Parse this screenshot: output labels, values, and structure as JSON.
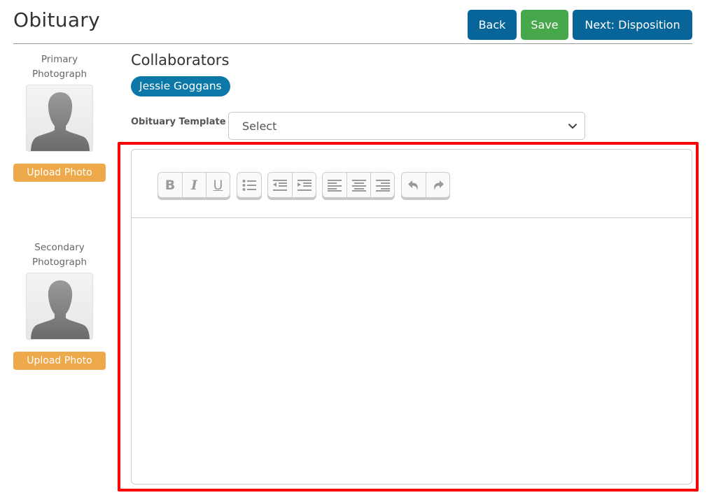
{
  "header": {
    "title": "Obituary",
    "buttons": {
      "back": "Back",
      "save": "Save",
      "next": "Next: Disposition"
    }
  },
  "colors": {
    "primary_blue": "#07659a",
    "save_green": "#47a74b",
    "chip_blue": "#0b78a8",
    "upload_orange": "#eeaa4a",
    "highlight_red": "#ff0000"
  },
  "photos": [
    {
      "label_line1": "Primary",
      "label_line2": "Photograph",
      "upload_label": "Upload Photo"
    },
    {
      "label_line1": "Secondary",
      "label_line2": "Photograph",
      "upload_label": "Upload Photo"
    }
  ],
  "collaborators": {
    "title": "Collaborators",
    "people": [
      "Jessie Goggans"
    ]
  },
  "template": {
    "label": "Obituary Template",
    "selected": "Select"
  },
  "editor": {
    "toolbar": {
      "bold": "B",
      "italic": "I",
      "underline": "U"
    },
    "content": ""
  }
}
